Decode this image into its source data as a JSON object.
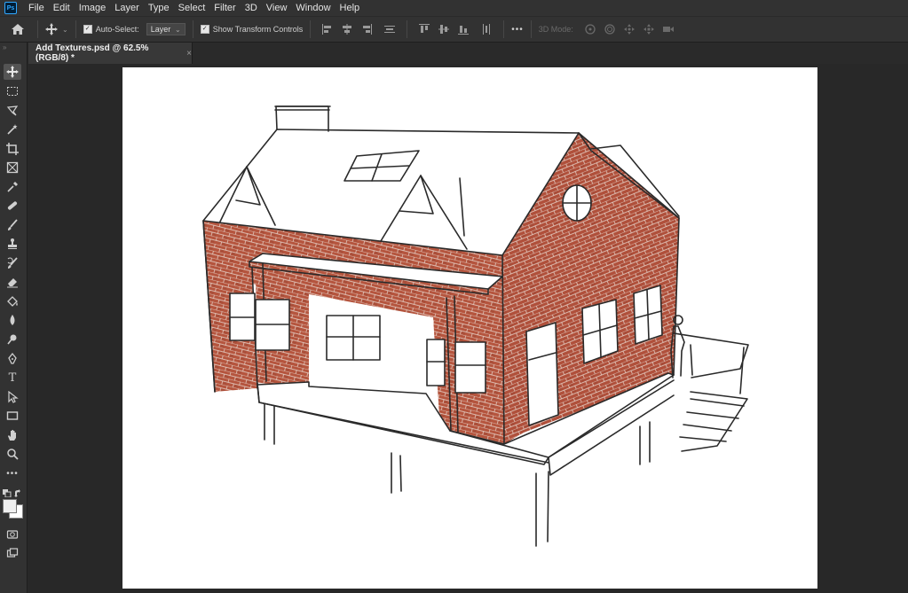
{
  "menubar": {
    "logo": "Ps",
    "items": [
      "File",
      "Edit",
      "Image",
      "Layer",
      "Type",
      "Select",
      "Filter",
      "3D",
      "View",
      "Window",
      "Help"
    ]
  },
  "options": {
    "auto_select_label": "Auto-Select:",
    "auto_select_checked": true,
    "layer_select_value": "Layer",
    "transform_controls_label": "Show Transform Controls",
    "transform_controls_checked": true,
    "more_label": "•••",
    "mode_3d_label": "3D Mode:"
  },
  "document": {
    "tab_title": "Add Textures.psd @ 62.5% (RGB/8) *",
    "close_glyph": "×"
  },
  "toolbar": {
    "type_tool_glyph": "T",
    "more_glyph": "•••"
  },
  "colors": {
    "brick": "#b5553e",
    "brick_dark": "#9c4533",
    "mortar": "#e8d8cf",
    "sketch_line": "#2a2a2a",
    "ui_dark": "#323232"
  }
}
